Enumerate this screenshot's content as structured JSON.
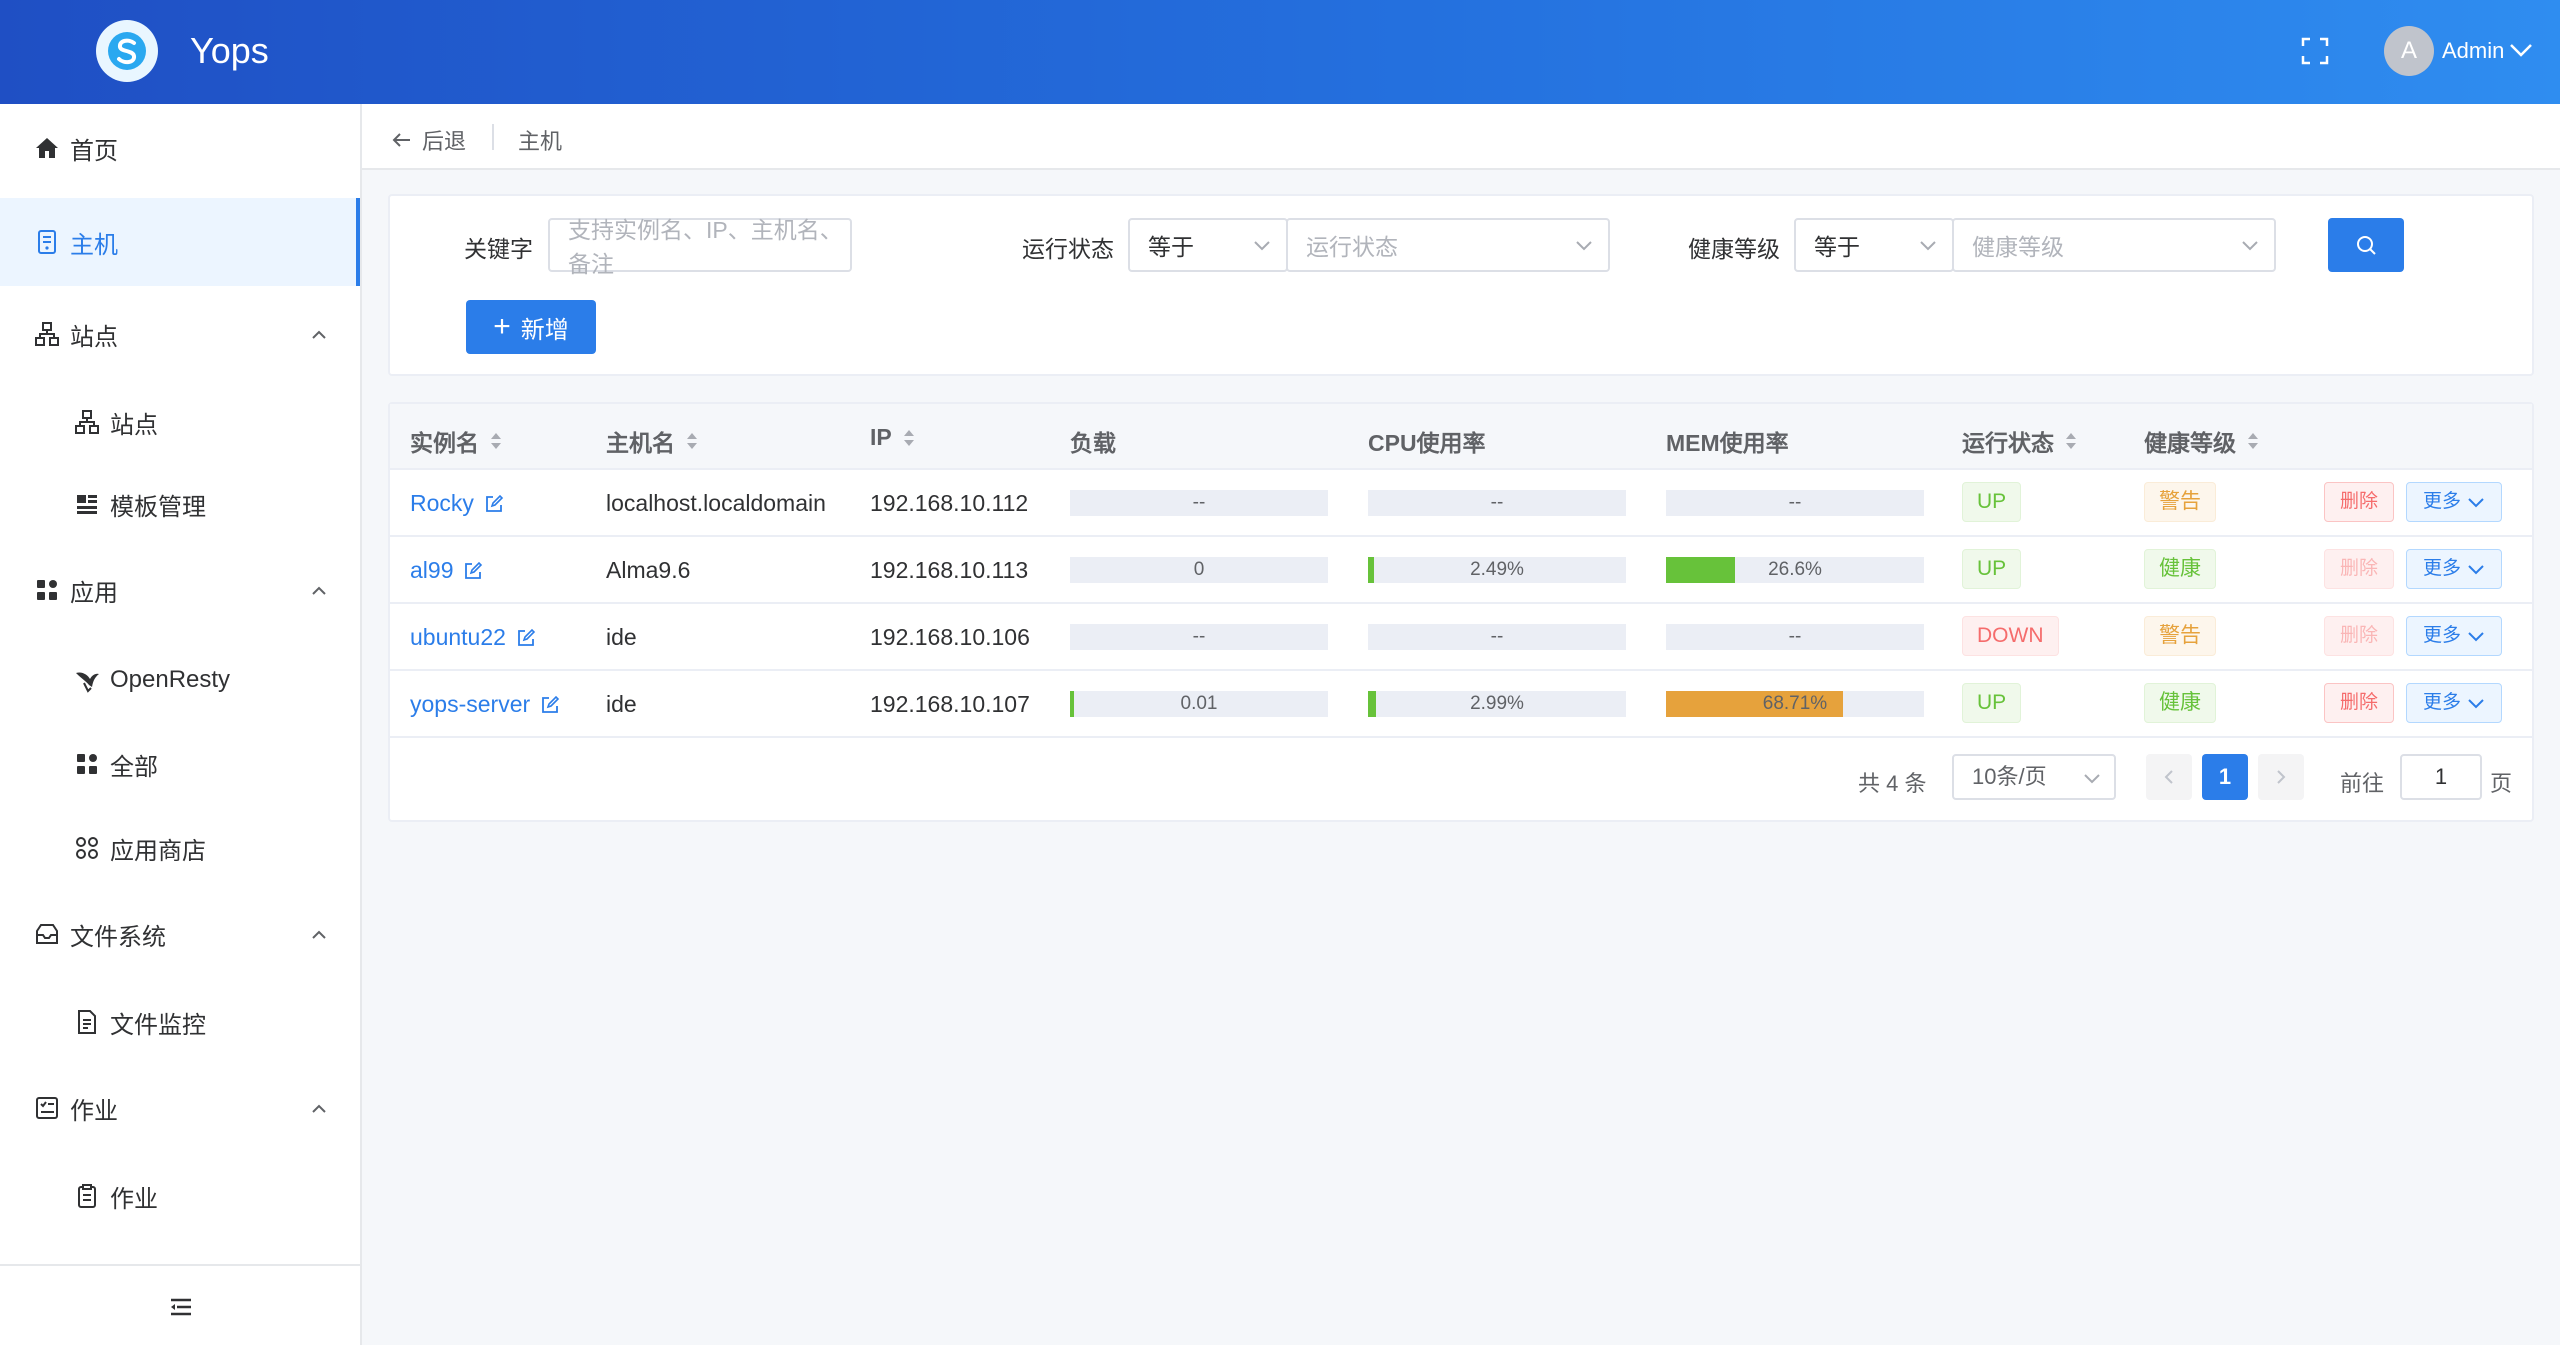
{
  "header": {
    "app_title": "Yops",
    "avatar_letter": "A",
    "user_name": "Admin"
  },
  "sidebar": {
    "items": [
      {
        "label": "首页",
        "icon": "home-icon"
      },
      {
        "label": "主机",
        "icon": "host-icon",
        "active": true
      },
      {
        "label": "站点",
        "icon": "site-tree-icon",
        "expanded": true
      },
      {
        "label": "站点",
        "icon": "site-tree-icon",
        "sub": true
      },
      {
        "label": "模板管理",
        "icon": "template-icon",
        "sub": true
      },
      {
        "label": "应用",
        "icon": "apps-icon",
        "expanded": true
      },
      {
        "label": "OpenResty",
        "icon": "openresty-icon",
        "sub": true
      },
      {
        "label": "全部",
        "icon": "apps-icon",
        "sub": true
      },
      {
        "label": "应用商店",
        "icon": "store-icon",
        "sub": true
      },
      {
        "label": "文件系统",
        "icon": "filesystem-icon",
        "expanded": true
      },
      {
        "label": "文件监控",
        "icon": "file-monitor-icon",
        "sub": true
      },
      {
        "label": "作业",
        "icon": "job-icon",
        "expanded": true
      },
      {
        "label": "作业",
        "icon": "clipboard-icon",
        "sub": true
      }
    ]
  },
  "breadcrumb": {
    "back": "后退",
    "current": "主机"
  },
  "filters": {
    "keyword_label": "关键字",
    "keyword_placeholder": "支持实例名、IP、主机名、备注",
    "status_label": "运行状态",
    "status_op": "等于",
    "status_placeholder": "运行状态",
    "health_label": "健康等级",
    "health_op": "等于",
    "health_placeholder": "健康等级",
    "add_label": "新增"
  },
  "table": {
    "columns": [
      "实例名",
      "主机名",
      "IP",
      "负载",
      "CPU使用率",
      "MEM使用率",
      "运行状态",
      "健康等级"
    ],
    "rows": [
      {
        "name": "Rocky",
        "hostname": "localhost.localdomain",
        "ip": "192.168.10.112",
        "load": "--",
        "load_pct": 0,
        "cpu": "--",
        "cpu_pct": 0,
        "mem": "--",
        "mem_pct": 0,
        "status": "UP",
        "health": "警告",
        "delete": "删除",
        "more": "更多",
        "delete_disabled": false
      },
      {
        "name": "al99",
        "hostname": "Alma9.6",
        "ip": "192.168.10.113",
        "load": "0",
        "load_pct": 0,
        "cpu": "2.49%",
        "cpu_pct": 2.49,
        "mem": "26.6%",
        "mem_pct": 26.6,
        "status": "UP",
        "health": "健康",
        "delete": "删除",
        "more": "更多",
        "delete_disabled": true
      },
      {
        "name": "ubuntu22",
        "hostname": "ide",
        "ip": "192.168.10.106",
        "load": "--",
        "load_pct": 0,
        "cpu": "--",
        "cpu_pct": 0,
        "mem": "--",
        "mem_pct": 0,
        "status": "DOWN",
        "health": "警告",
        "delete": "删除",
        "more": "更多",
        "delete_disabled": true
      },
      {
        "name": "yops-server",
        "hostname": "ide",
        "ip": "192.168.10.107",
        "load": "0.01",
        "load_pct": 1,
        "cpu": "2.99%",
        "cpu_pct": 2.99,
        "mem": "68.71%",
        "mem_pct": 68.71,
        "status": "UP",
        "health": "健康",
        "delete": "删除",
        "more": "更多",
        "delete_disabled": false
      }
    ]
  },
  "pagination": {
    "total": "共 4 条",
    "page_size": "10条/页",
    "current_page": "1",
    "goto_label": "前往",
    "goto_value": "1",
    "page_unit": "页"
  },
  "colors": {
    "primary": "#2b7de9",
    "bar_green": "#67c23a",
    "bar_orange": "#e6a23c"
  }
}
